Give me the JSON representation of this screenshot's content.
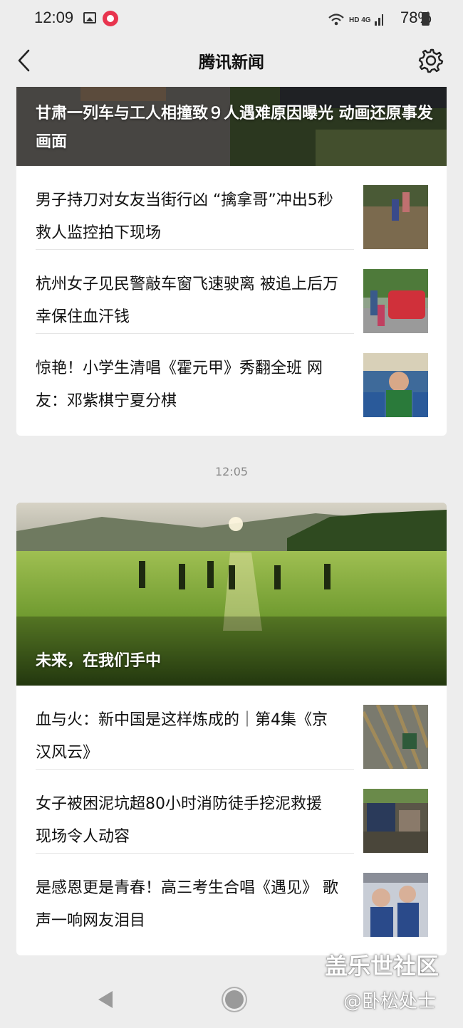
{
  "status_bar": {
    "time": "12:09",
    "battery": "78%",
    "network": "HD 4G"
  },
  "header": {
    "title": "腾讯新闻"
  },
  "feed_top": {
    "hero_caption": "甘肃一列车与工人相撞致９人遇难原因曝光 动画还原事发画面",
    "articles": [
      {
        "title": "男子持刀对女友当街行凶 “擒拿哥”冲出5秒救人监控拍下现场"
      },
      {
        "title": "杭州女子见民警敲车窗飞速驶离 被追上后万幸保住血汗钱"
      },
      {
        "title": "惊艳！小学生清唱《霍元甲》秀翻全班 网友：邓紫棋宁夏分棋"
      }
    ]
  },
  "timestamp": "12:05",
  "feed_bottom": {
    "hero_caption": "未来，在我们手中",
    "articles": [
      {
        "title": "血与火：新中国是这样炼成的｜第4集《京汉风云》"
      },
      {
        "title": "女子被困泥坑超80小时消防徒手挖泥救援 现场令人动容"
      },
      {
        "title": "是感恩更是青春！高三考生合唱《遇见》 歌声一响网友泪目"
      }
    ]
  },
  "watermark": {
    "line1": "盖乐世社区",
    "line2": "@卧松处士"
  },
  "colors": {
    "background": "#ededed",
    "card": "#ffffff",
    "timestamp": "#8a8a8a"
  },
  "icons": [
    "back-icon",
    "settings-gear-icon",
    "nav-back-icon",
    "nav-home-icon",
    "wifi-icon",
    "signal-icon",
    "battery-icon",
    "gallery-icon",
    "app-notification-icon"
  ]
}
